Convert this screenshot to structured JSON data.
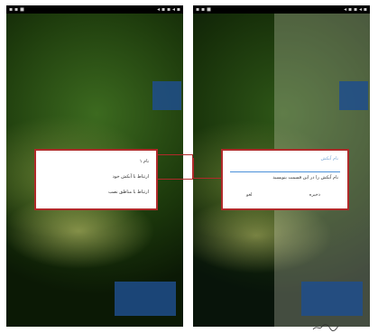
{
  "status_bar": {
    "left_text": "▪ ▪ ◼",
    "right_text": "◂ ▪ ▪ ◂ ▪"
  },
  "left_screen": {
    "menu_items": [
      "نام ۱",
      "ارتباط با آبکش خود",
      "ارتباط با مناطق نصب"
    ]
  },
  "right_screen": {
    "dialog_title": "نام آبکش",
    "dialog_message": "نام آبکش را در این قسمت بنویسید",
    "cancel_label": "لغو",
    "ok_label": "ذخیره"
  },
  "colors": {
    "highlight": "#b02a2a",
    "accent_blue": "#1f4e8c",
    "input_line": "#4a90d9"
  },
  "icons": [
    "signal-icon",
    "battery-icon",
    "wifi-icon"
  ]
}
